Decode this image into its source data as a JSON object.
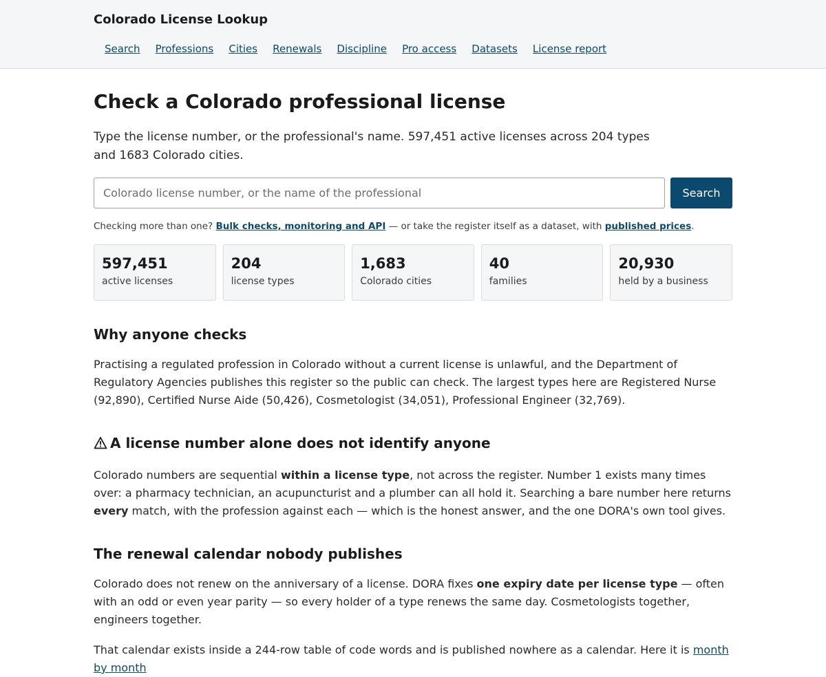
{
  "header": {
    "brand": "Colorado License Lookup",
    "nav": [
      "Search",
      "Professions",
      "Cities",
      "Renewals",
      "Discipline",
      "Pro access",
      "Datasets",
      "License report"
    ]
  },
  "hero": {
    "title": "Check a Colorado professional license",
    "lede": "Type the license number, or the professional's name. 597,451 active licenses across 204 types and 1683 Colorado cities.",
    "search_placeholder": "Colorado license number, or the name of the professional",
    "search_value": "",
    "search_button": "Search",
    "bulk_prefix": "Checking more than one? ",
    "bulk_link": "Bulk checks, monitoring and API",
    "bulk_middle": " — or take the register itself as a dataset, with ",
    "prices_link": "published prices",
    "bulk_suffix": "."
  },
  "stats": [
    {
      "value": "597,451",
      "label": "active licenses"
    },
    {
      "value": "204",
      "label": "license types"
    },
    {
      "value": "1,683",
      "label": "Colorado cities"
    },
    {
      "value": "40",
      "label": "families"
    },
    {
      "value": "20,930",
      "label": "held by a business"
    }
  ],
  "sections": {
    "why": {
      "title": "Why anyone checks",
      "body": "Practising a regulated profession in Colorado without a current license is unlawful, and the Department of Regulatory Agencies publishes this register so the public can check. The largest types here are Registered Nurse (92,890), Certified Nurse Aide (50,426), Cosmetologist (34,051), Professional Engineer (32,769)."
    },
    "number": {
      "title": "A license number alone does not identify anyone",
      "p1": "Colorado numbers are sequential ",
      "b1": "within a license type",
      "p2": ", not across the register. Number 1 exists many times over: a pharmacy technician, an acupuncturist and a plumber can all hold it. Searching a bare number here returns ",
      "b2": "every",
      "p3": " match, with the profession against each — which is the honest answer, and the one DORA's own tool gives."
    },
    "renewal": {
      "title": "The renewal calendar nobody publishes",
      "p1": "Colorado does not renew on the anniversary of a license. DORA fixes ",
      "b1": "one expiry date per license type",
      "p2": " — often with an odd or even year parity — so every holder of a type renews the same day. Cosmetologists together, engineers together.",
      "p3": "That calendar exists inside a 244-row table of code words and is published nowhere as a calendar. Here it is ",
      "link": "month by month"
    }
  },
  "colors": {
    "accent": "#0b4a6e",
    "header_bg": "#f5f6f7"
  }
}
